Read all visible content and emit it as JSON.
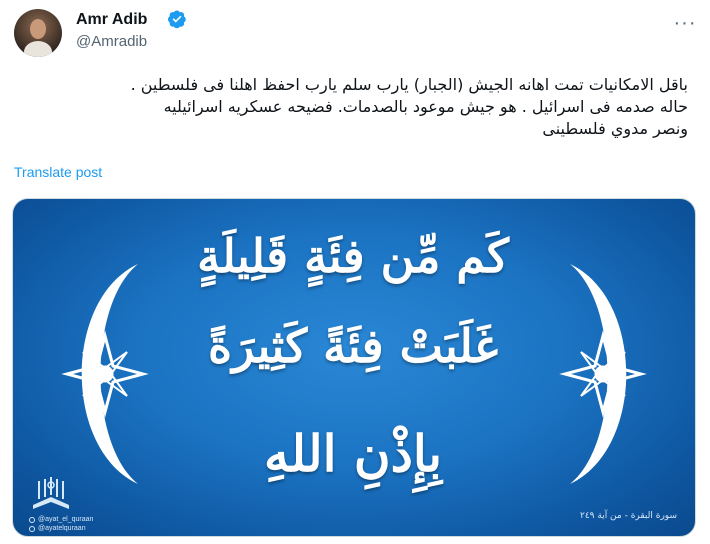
{
  "author": {
    "display_name": "Amr Adib",
    "handle": "@Amradib",
    "verified_icon": "verified-badge-icon",
    "verified_color": "#1d9bf0"
  },
  "more_icon": "more-horizontal-icon",
  "more_label": "···",
  "tweet": {
    "lines": [
      "باقل الامكانيات تمت اهانه الجيش (الجبار) يارب سلم يارب احفظ اهلنا فى فلسطين .",
      "حاله صدمه فى اسرائيل . هو جيش موعود بالصدمات. فضيحه عسكريه اسرائيليه",
      "ونصر مدوي فلسطينى"
    ]
  },
  "translate_label": "Translate post",
  "link_color": "#1d9bf0",
  "media": {
    "verse_lines": [
      "كَم مِّن فِئَةٍ قَلِيلَةٍ",
      "غَلَبَتْ فِئَةً كَثِيرَةً",
      "بِإِذْنِ اللهِ"
    ],
    "social_handles": [
      "@ayat_el_quraan",
      "@ayatelquraan"
    ],
    "source": "سورة البقرة - من آية ٢٤٩",
    "background_color": "#1b73c2"
  }
}
